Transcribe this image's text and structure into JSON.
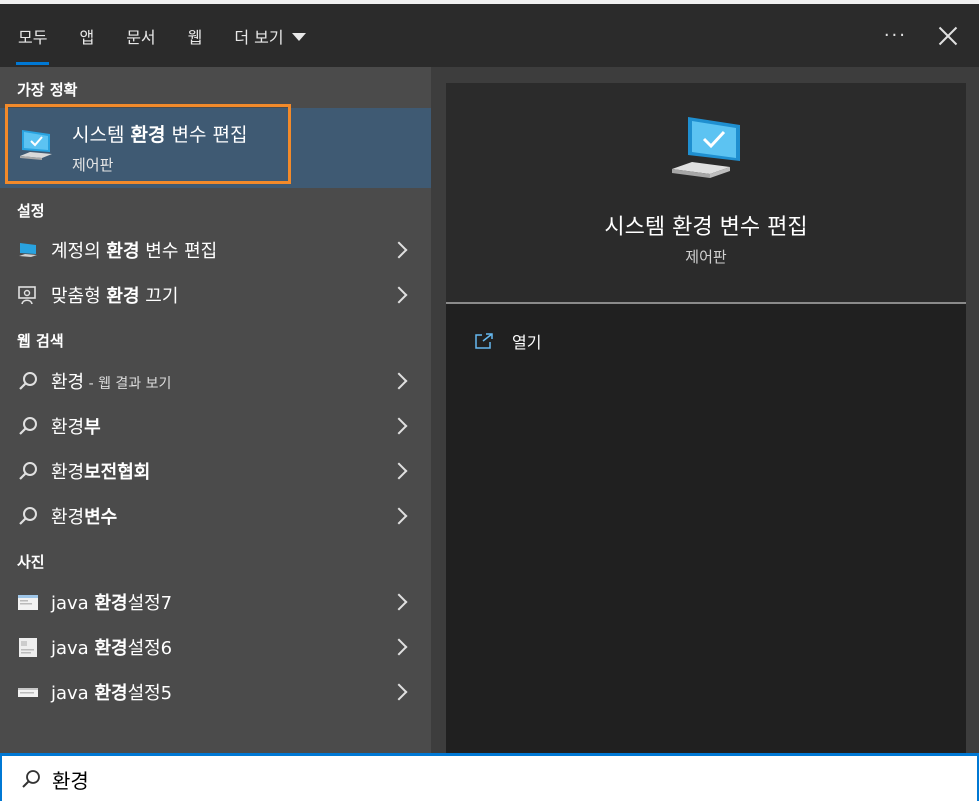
{
  "header": {
    "tabs": [
      {
        "label": "모두",
        "active": true
      },
      {
        "label": "앱"
      },
      {
        "label": "문서"
      },
      {
        "label": "웹"
      },
      {
        "label": "더 보기"
      }
    ],
    "more_label": "···"
  },
  "best_match": {
    "section": "가장 정확",
    "title_parts": [
      "시스템 ",
      "환경",
      " 변수 편집"
    ],
    "subtitle": "제어판",
    "icon": "monitor-check-icon"
  },
  "settings": {
    "section": "설정",
    "items": [
      {
        "parts": [
          "계정의 ",
          "환경",
          " 변수 편집"
        ],
        "icon": "monitor-icon"
      },
      {
        "parts": [
          "맞춤형 ",
          "환경",
          " 끄기"
        ],
        "icon": "feedback-icon"
      }
    ]
  },
  "web": {
    "section": "웹 검색",
    "items": [
      {
        "parts": [
          "환경",
          "",
          ""
        ],
        "suffix": " - 웹 결과 보기",
        "icon": "search-icon"
      },
      {
        "parts": [
          "환경",
          "부",
          ""
        ],
        "icon": "search-icon"
      },
      {
        "parts": [
          "환경",
          "보전협회",
          ""
        ],
        "icon": "search-icon"
      },
      {
        "parts": [
          "환경",
          "변수",
          ""
        ],
        "icon": "search-icon"
      }
    ]
  },
  "photos": {
    "section": "사진",
    "items": [
      {
        "parts": [
          "java ",
          "환경",
          "설정7"
        ],
        "icon": "image-thumbnail-icon"
      },
      {
        "parts": [
          "java ",
          "환경",
          "설정6"
        ],
        "icon": "image-thumbnail-icon"
      },
      {
        "parts": [
          "java ",
          "환경",
          "설정5"
        ],
        "icon": "image-thumbnail-icon"
      }
    ]
  },
  "detail": {
    "title": "시스템 환경 변수 편집",
    "subtitle": "제어판",
    "actions": [
      {
        "label": "열기",
        "icon": "open-icon"
      }
    ]
  },
  "search": {
    "value": "환경"
  },
  "colors": {
    "accent": "#0078d4",
    "highlight_outline": "#f28a2a",
    "selected_bg": "#3f5a73"
  }
}
